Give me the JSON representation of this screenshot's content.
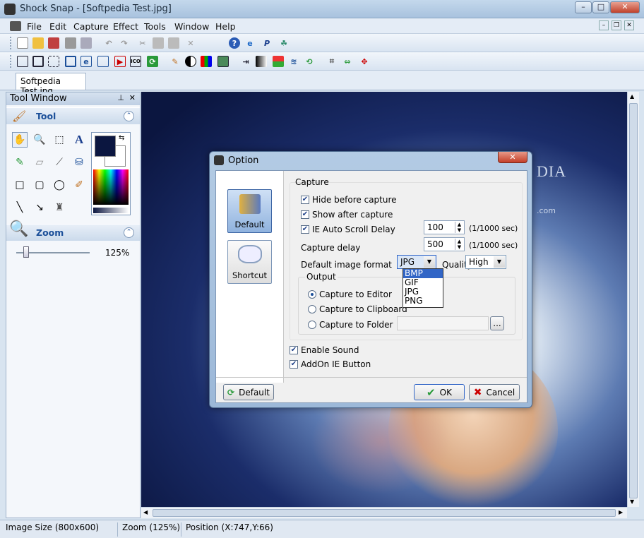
{
  "window": {
    "title": "Shock Snap - [Softpedia Test.jpg]"
  },
  "menu": [
    "File",
    "Edit",
    "Capture",
    "Effect",
    "Tools",
    "Window",
    "Help"
  ],
  "tabs": [
    {
      "label": "Softpedia Test.jpg"
    }
  ],
  "tool_window": {
    "title": "Tool Window",
    "tool_section": "Tool",
    "zoom_section": "Zoom",
    "zoom_value": "125%"
  },
  "status": {
    "image_size": "Image Size (800x600)",
    "zoom": "Zoom (125%)",
    "position": "Position (X:747,Y:66)"
  },
  "dialog": {
    "title": "Option",
    "panes": [
      "Default",
      "Shortcut"
    ],
    "capture_group": "Capture",
    "hide_before_capture": "Hide before capture",
    "show_after_capture": "Show after capture",
    "ie_auto_scroll": "IE Auto Scroll Delay",
    "ie_scroll_value": "100",
    "unit": "(1/1000 sec)",
    "capture_delay": "Capture delay",
    "capture_delay_value": "500",
    "default_format_label": "Default image format",
    "format_selected": "JPG",
    "format_options": [
      "BMP",
      "GIF",
      "JPG",
      "PNG"
    ],
    "quality_label": "Quality",
    "quality_value": "High",
    "output_group": "Output",
    "to_editor": "Capture to Editor",
    "to_clipboard": "Capture to Clipboard",
    "to_folder": "Capture to Folder",
    "browse": "...",
    "enable_sound": "Enable Sound",
    "addon_ie": "AddOn IE Button",
    "default_btn": "Default",
    "ok_btn": "OK",
    "cancel_btn": "Cancel"
  },
  "colors": {
    "accent": "#1b4f99",
    "selection": "#3165c6"
  }
}
